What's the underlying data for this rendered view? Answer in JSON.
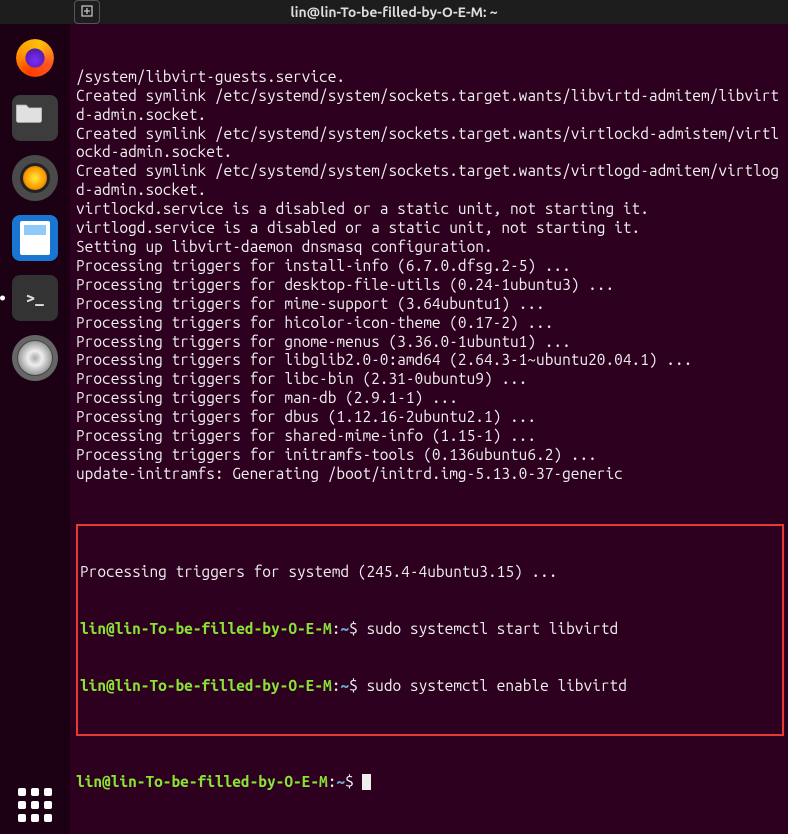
{
  "window": {
    "title": "lin@lin-To-be-filled-by-O-E-M: ~",
    "new_tab_glyph": "⊞"
  },
  "dock": {
    "firefox": "firefox",
    "files": "files",
    "rhythmbox": "rhythmbox",
    "writer": "libreoffice-writer",
    "terminal": "terminal",
    "terminal_glyph": ">_",
    "disks": "disks",
    "apps": "show-applications"
  },
  "terminal": {
    "lines": [
      "/system/libvirt-guests.service.",
      "Created symlink /etc/systemd/system/sockets.target.wants/libvirtd-admitem/libvirtd-admin.socket.",
      "Created symlink /etc/systemd/system/sockets.target.wants/virtlockd-admistem/virtlockd-admin.socket.",
      "Created symlink /etc/systemd/system/sockets.target.wants/virtlogd-admitem/virtlogd-admin.socket.",
      "virtlockd.service is a disabled or a static unit, not starting it.",
      "virtlogd.service is a disabled or a static unit, not starting it.",
      "Setting up libvirt-daemon dnsmasq configuration.",
      "Processing triggers for install-info (6.7.0.dfsg.2-5) ...",
      "Processing triggers for desktop-file-utils (0.24-1ubuntu3) ...",
      "Processing triggers for mime-support (3.64ubuntu1) ...",
      "Processing triggers for hicolor-icon-theme (0.17-2) ...",
      "Processing triggers for gnome-menus (3.36.0-1ubuntu1) ...",
      "Processing triggers for libglib2.0-0:amd64 (2.64.3-1~ubuntu20.04.1) ...",
      "Processing triggers for libc-bin (2.31-0ubuntu9) ...",
      "Processing triggers for man-db (2.9.1-1) ...",
      "Processing triggers for dbus (1.12.16-2ubuntu2.1) ...",
      "Processing triggers for shared-mime-info (1.15-1) ...",
      "Processing triggers for initramfs-tools (0.136ubuntu6.2) ...",
      "update-initramfs: Generating /boot/initrd.img-5.13.0-37-generic"
    ],
    "boxed": {
      "line1": "Processing triggers for systemd (245.4-4ubuntu3.15) ...",
      "prompt_user": "lin@lin-To-be-filled-by-O-E-M",
      "prompt_sep": ":",
      "prompt_path": "~",
      "prompt_dollar": "$",
      "cmd1": "sudo systemctl start libvirtd",
      "cmd2": "sudo systemctl enable libvirtd"
    },
    "after_user": "lin@lin-To-be-filled-by-O-E-M",
    "after_sep": ":",
    "after_path": "~",
    "after_dollar": "$"
  }
}
